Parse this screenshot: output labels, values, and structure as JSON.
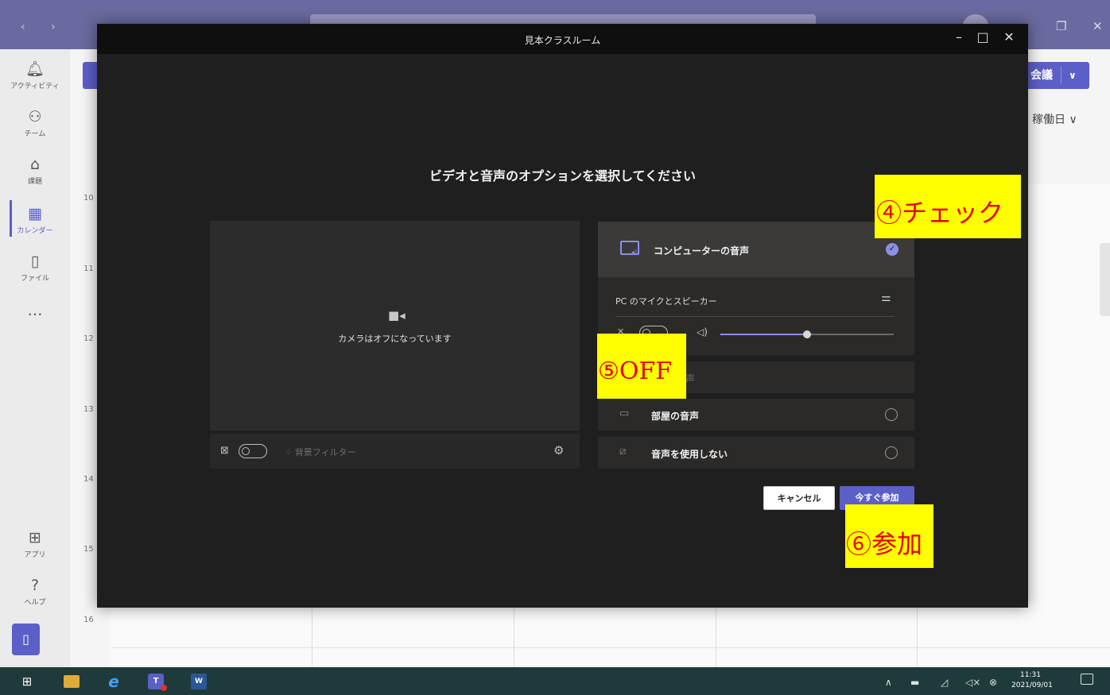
{
  "teams": {
    "rail": [
      {
        "label": "アクティビティ",
        "icon": "bell-icon"
      },
      {
        "label": "チーム",
        "icon": "people-icon"
      },
      {
        "label": "課題",
        "icon": "backpack-icon"
      },
      {
        "label": "カレンダー",
        "icon": "calendar-icon"
      },
      {
        "label": "ファイル",
        "icon": "file-icon"
      },
      {
        "label": "…",
        "icon": "more-icon"
      },
      {
        "label": "アプリ",
        "icon": "apps-icon"
      },
      {
        "label": "ヘルプ",
        "icon": "help-icon"
      }
    ],
    "new_meeting_label": "会議",
    "view_label": "稼働日",
    "hours": [
      "10",
      "11",
      "12",
      "13",
      "14",
      "15",
      "16"
    ]
  },
  "dialog": {
    "title": "見本クラスルーム",
    "prompt": "ビデオと音声のオプションを選択してください",
    "camera_off_text": "カメラはオフになっています",
    "background_filter_label": "背景フィルター",
    "audio_options": {
      "computer_audio": "コンピューターの音声",
      "device_label": "PC のマイクとスピーカー",
      "phone_audio_partial": "声",
      "room_audio": "部屋の音声",
      "no_audio": "音声を使用しない"
    },
    "speaker_volume": 0.5,
    "cancel_label": "キャンセル",
    "join_label": "今すぐ参加"
  },
  "annotations": {
    "check": "④チェック",
    "off": "⑤OFF",
    "join": "⑥参加"
  },
  "taskbar": {
    "time": "11:31",
    "date": "2021/09/01"
  },
  "colors": {
    "accent": "#5b5fc7",
    "callout_bg": "#ffff00",
    "callout_text": "#e60000"
  }
}
